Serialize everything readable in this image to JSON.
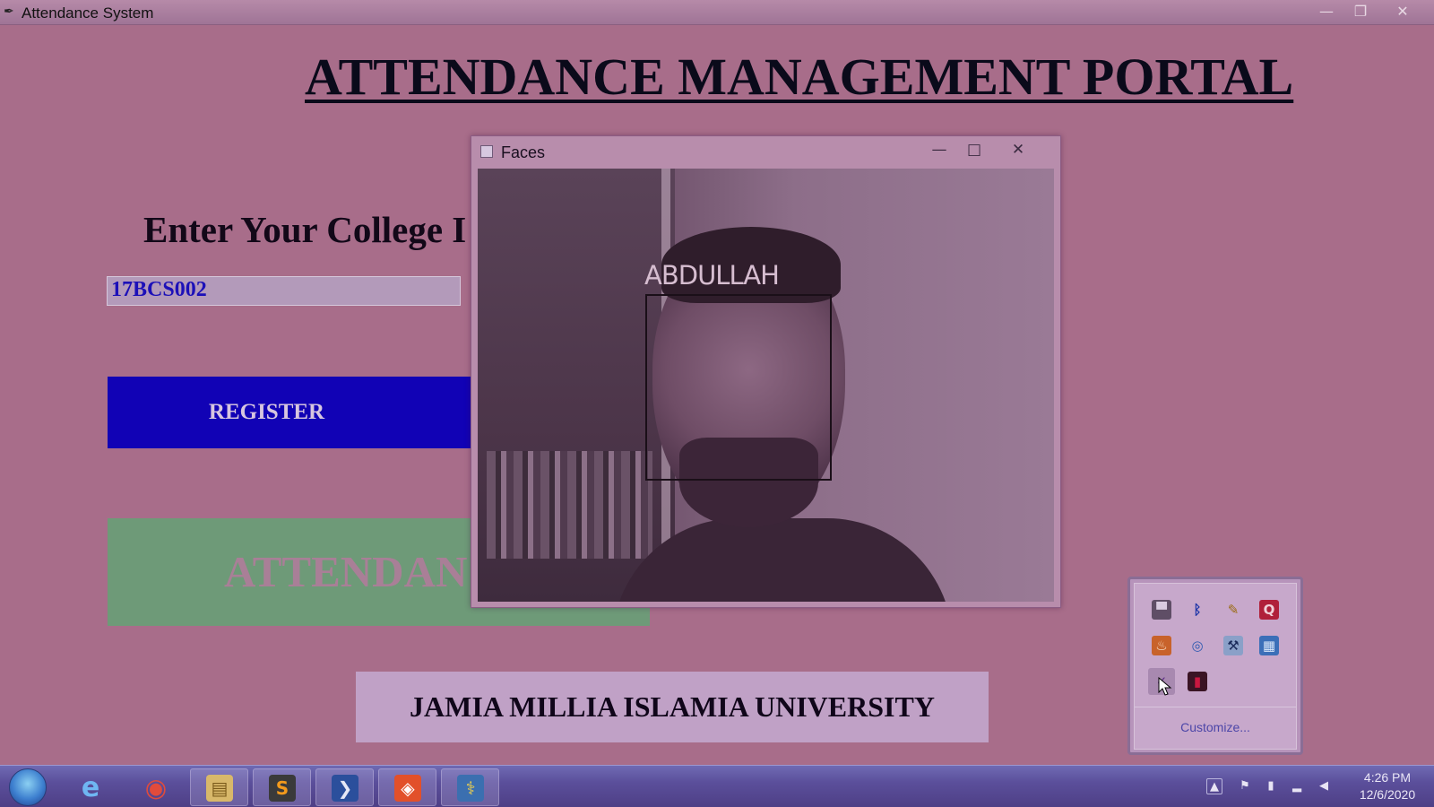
{
  "window": {
    "title": "Attendance System",
    "minimize": "—",
    "maximize": "❐",
    "close": "✕"
  },
  "main": {
    "portal_title": "ATTENDANCE MANAGEMENT PORTAL",
    "id_label": "Enter Your College I",
    "id_value": "17BCS002",
    "register_label": "REGISTER",
    "attendance_label": "ATTENDAN",
    "footer": "JAMIA MILLIA ISLAMIA UNIVERSITY"
  },
  "faces_window": {
    "title": "Faces",
    "minimize": "—",
    "maximize": "□",
    "close": "✕",
    "face_label": "ABDULLAH"
  },
  "tray_popup": {
    "icons": [
      {
        "name": "monitor-icon",
        "glyph": "▀"
      },
      {
        "name": "bluetooth-icon",
        "glyph": "ᛒ"
      },
      {
        "name": "pen-tool-icon",
        "glyph": "✎"
      },
      {
        "name": "q-app-icon",
        "glyph": "Q"
      },
      {
        "name": "java-icon",
        "glyph": "♨"
      },
      {
        "name": "sync-icon",
        "glyph": "◎"
      },
      {
        "name": "settings-tool-icon",
        "glyph": "⚒"
      },
      {
        "name": "network-monitor-icon",
        "glyph": "▦"
      },
      {
        "name": "python-tray-icon",
        "glyph": "✓"
      },
      {
        "name": "app-tray-icon",
        "glyph": "▮"
      }
    ],
    "customize_label": "Customize..."
  },
  "taskbar": {
    "apps": [
      {
        "name": "internet-explorer-icon",
        "glyph": "e"
      },
      {
        "name": "chrome-icon",
        "glyph": "◉"
      },
      {
        "name": "file-explorer-icon",
        "glyph": "▤"
      },
      {
        "name": "sublime-text-icon",
        "glyph": "S"
      },
      {
        "name": "powershell-icon",
        "glyph": "❯"
      },
      {
        "name": "brave-icon",
        "glyph": "◈"
      },
      {
        "name": "python-icon",
        "glyph": "⚕"
      }
    ],
    "clock_time": "4:26 PM",
    "clock_date": "12/6/2020"
  },
  "colors": {
    "background": "#a86d8a",
    "register_bg": "#1102b5",
    "attendance_bg": "#6e9a78",
    "footer_bg": "#c0a1c6",
    "input_text": "#1c10b8"
  }
}
